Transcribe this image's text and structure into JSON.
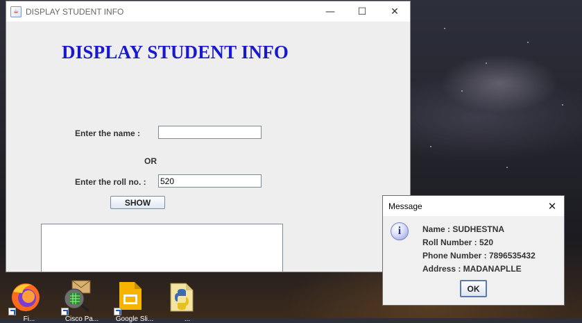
{
  "main_window": {
    "title": "DISPLAY STUDENT INFO",
    "app_icon": "java-cup-icon",
    "controls": {
      "minimize": "—",
      "maximize": "☐",
      "close": "✕"
    },
    "heading": "DISPLAY STUDENT INFO",
    "name_label": "Enter the name :",
    "name_value": "",
    "or_label": "OR",
    "roll_label": "Enter the roll no. :",
    "roll_value": "520",
    "show_button": "SHOW",
    "output_text": ""
  },
  "message_dialog": {
    "title": "Message",
    "close": "✕",
    "icon": "info-icon",
    "info_glyph": "i",
    "lines": [
      "Name : SUDHESTNA",
      "Roll Number : 520",
      "Phone Number : 7896535432",
      "Address : MADANAPLLE"
    ],
    "ok_button": "OK"
  },
  "desktop_icons": [
    {
      "name": "firefox-icon",
      "label": "Fi..."
    },
    {
      "name": "cisco-packet-tracer-icon",
      "label": "Cisco Pa..."
    },
    {
      "name": "google-slides-icon",
      "label": "Google Sli..."
    },
    {
      "name": "python-file-icon",
      "label": "..."
    }
  ],
  "colors": {
    "heading": "#1818cc",
    "window_bg": "#eeeeee",
    "dialog_bg": "#f0f0f0"
  }
}
